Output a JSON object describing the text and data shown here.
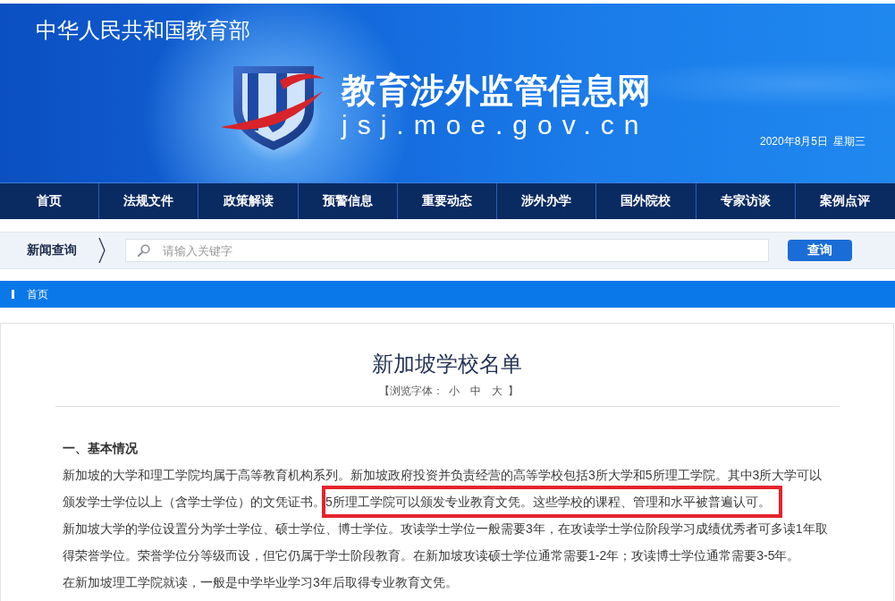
{
  "header": {
    "ministry": "中华人民共和国教育部",
    "site_name": "教育涉外监管信息网",
    "domain": "jsj.moe.gov.cn",
    "date": "2020年8月5日",
    "weekday": "星期三"
  },
  "nav": [
    "首页",
    "法规文件",
    "政策解读",
    "预警信息",
    "重要动态",
    "涉外办学",
    "国外院校",
    "专家访谈",
    "案例点评"
  ],
  "search": {
    "label": "新闻查询",
    "placeholder": "请输入关键字",
    "button": "查询"
  },
  "breadcrumb": [
    "首页"
  ],
  "article": {
    "title": "新加坡学校名单",
    "font_size": {
      "prefix": "【浏览字体：",
      "options": [
        "小",
        "中",
        "大"
      ],
      "suffix": "】"
    },
    "section_heading": "一、基本情况",
    "paragraphs": [
      {
        "segments": [
          {
            "text": "新加坡的大学和理工学院均属于高等教育机构系列。新加坡政府投资并负责经营的高等学校包括3所大学和5所理工学院。其中3所大学可以颁发学士学位以上（含学士学位）的文凭证书。",
            "highlighted": false
          },
          {
            "text": "5所理工学院可以颁发专业教育文凭。这些学校的课程、管理和水平被普遍认可。",
            "highlighted": true
          }
        ]
      },
      {
        "segments": [
          {
            "text": "新加坡大学的学位设置分为学士学位、硕士学位、博士学位。攻读学士学位一般需要3年，在攻读学士学位阶段学习成绩优秀者可多读1年取得荣誉学位。荣誉学位分等级而设，但它仍属于学士阶段教育。在新加坡攻读硕士学位通常需要1-2年；攻读博士学位通常需要3-5年。",
            "highlighted": false
          }
        ]
      },
      {
        "segments": [
          {
            "text": "在新加坡理工学院就读，一般是中学毕业学习3年后取得专业教育文凭。",
            "highlighted": false
          }
        ]
      }
    ]
  }
}
